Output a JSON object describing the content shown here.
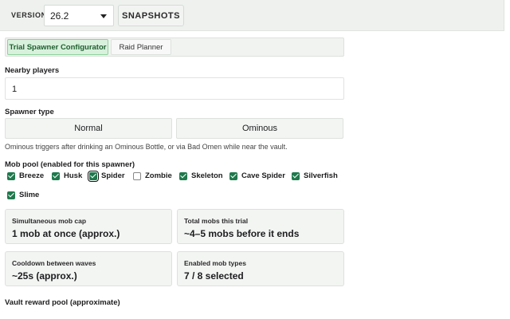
{
  "topbar": {
    "version_label": "VERSION",
    "version_value": "26.2",
    "snapshots_label": "SNAPSHOTS"
  },
  "tabs": [
    {
      "label": "Trial Spawner Configurator",
      "active": true
    },
    {
      "label": "Raid Planner",
      "active": false
    }
  ],
  "form": {
    "players_label": "Nearby players",
    "players_value": "1",
    "spawner_type_label": "Spawner type",
    "spawner_types": [
      "Normal",
      "Ominous"
    ],
    "spawner_note": "Ominous triggers after drinking an Ominous Bottle, or via Bad Omen while near the vault.",
    "mob_pool_label": "Mob pool (enabled for this spawner)",
    "mobs": [
      {
        "name": "Breeze",
        "checked": true
      },
      {
        "name": "Husk",
        "checked": true
      },
      {
        "name": "Spider",
        "checked": true
      },
      {
        "name": "Zombie",
        "checked": false
      },
      {
        "name": "Skeleton",
        "checked": true
      },
      {
        "name": "Cave Spider",
        "checked": true
      },
      {
        "name": "Silverfish",
        "checked": true
      },
      {
        "name": "Slime",
        "checked": true
      }
    ]
  },
  "stats": [
    {
      "title": "Simultaneous mob cap",
      "value": "1 mob at once (approx.)"
    },
    {
      "title": "Total mobs this trial",
      "value": "~4–5 mobs before it ends"
    },
    {
      "title": "Cooldown between waves",
      "value": "~25s (approx.)"
    },
    {
      "title": "Enabled mob types",
      "value": "7 / 8 selected"
    }
  ],
  "vault_label": "Vault reward pool (approximate)",
  "colors": {
    "accent": "#1f7a4d",
    "tab_active_bg": "#d8f1dd",
    "topbar_bg": "#eef1ee"
  }
}
